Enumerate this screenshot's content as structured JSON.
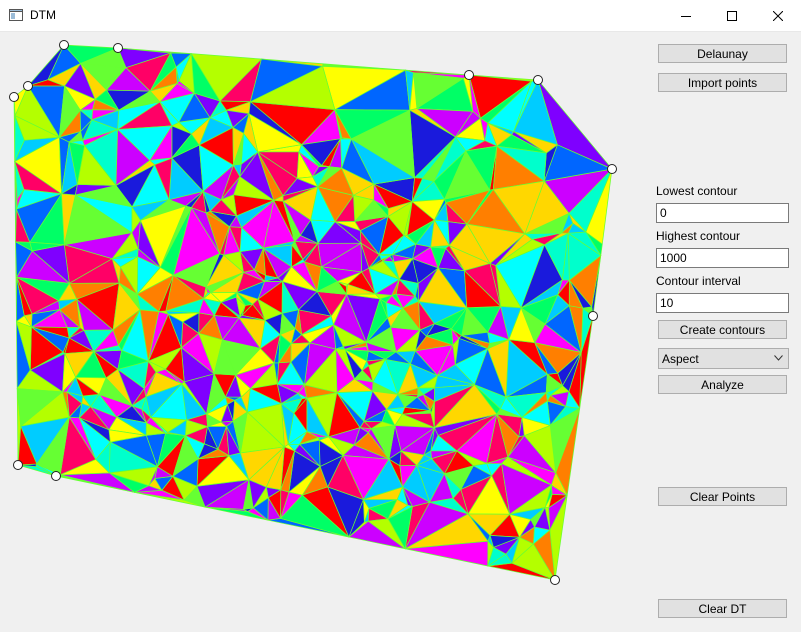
{
  "window": {
    "title": "DTM",
    "icon": "window-app-icon",
    "controls": [
      "minimize-icon",
      "maximize-icon",
      "close-icon"
    ]
  },
  "toolbar": {
    "delaunay_label": "Delaunay",
    "import_label": "Import points",
    "create_contours_label": "Create contours",
    "analyze_label": "Analyze",
    "clear_points_label": "Clear Points",
    "clear_dt_label": "Clear DT"
  },
  "contours": {
    "lowest_label": "Lowest contour",
    "lowest_value": "0",
    "highest_label": "Highest contour",
    "highest_value": "1000",
    "interval_label": "Contour interval",
    "interval_value": "10"
  },
  "analysis": {
    "selected": "Aspect"
  },
  "colors": {
    "edge": "#66ff33",
    "palette": [
      "#ff0000",
      "#ff7f00",
      "#ffd700",
      "#ffff00",
      "#b4ff00",
      "#66ff33",
      "#00ff66",
      "#00ffcc",
      "#00ffff",
      "#00ccff",
      "#0066ff",
      "#1a1adc",
      "#7f00ff",
      "#cc00ff",
      "#ff00ff",
      "#ff0066"
    ]
  }
}
